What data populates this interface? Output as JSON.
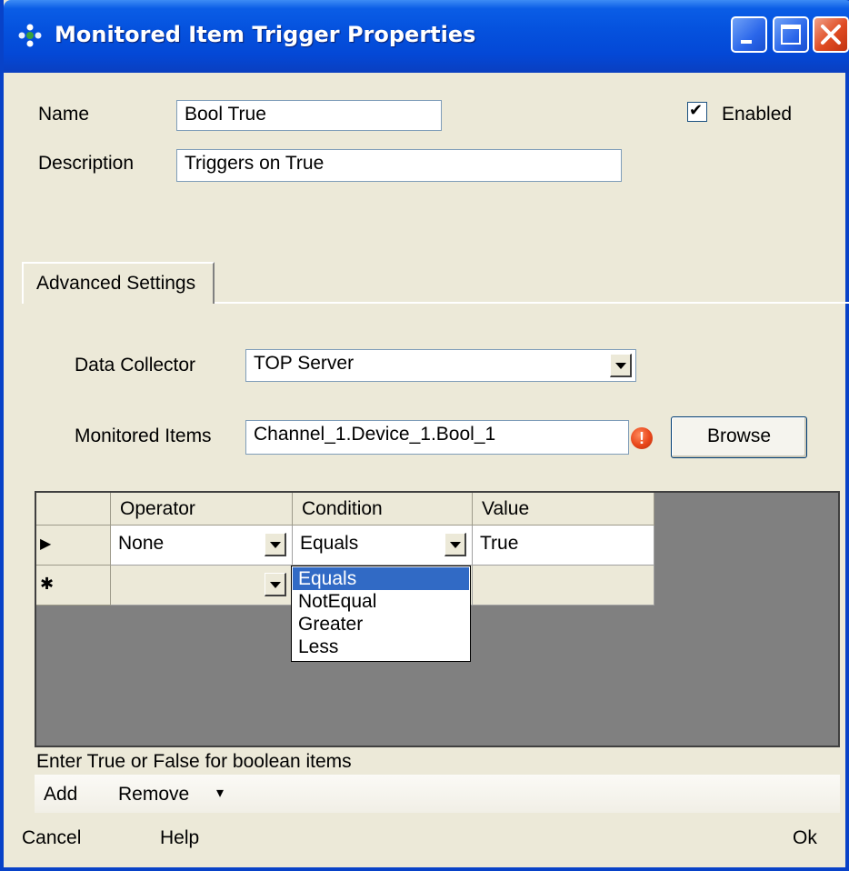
{
  "window": {
    "title": "Monitored Item Trigger Properties",
    "colors": {
      "titlebar": "#0552de",
      "face": "#ece9d8",
      "selection": "#316ac5",
      "grid_background": "#808080"
    }
  },
  "form": {
    "name_label": "Name",
    "name_value": "Bool True",
    "description_label": "Description",
    "description_value": "Triggers on True",
    "enabled_label": "Enabled",
    "enabled_checked": true
  },
  "tabs": [
    {
      "label": "Advanced Settings",
      "selected": true
    }
  ],
  "advanced": {
    "data_collector_label": "Data Collector",
    "data_collector_value": "TOP Server",
    "monitored_items_label": "Monitored Items",
    "monitored_items_value": "Channel_1.Device_1.Bool_1",
    "browse_label": "Browse",
    "warning_glyph": "!"
  },
  "grid": {
    "columns": [
      "Operator",
      "Condition",
      "Value"
    ],
    "rows": [
      {
        "indicator": "current-row-arrow",
        "operator": "None",
        "condition": "Equals",
        "value": "True"
      },
      {
        "indicator": "new-row-asterisk",
        "operator": "",
        "condition": "",
        "value": ""
      }
    ],
    "indicator_symbols": {
      "current": "▶",
      "new": "✱"
    },
    "condition_dropdown": {
      "open": true,
      "options": [
        "Equals",
        "NotEqual",
        "Greater",
        "Less"
      ],
      "selected": "Equals"
    }
  },
  "hint": "Enter True or False for boolean items",
  "toolbar": {
    "add_label": "Add",
    "remove_label": "Remove",
    "dropdown_arrow": "▾"
  },
  "footer": {
    "cancel_label": "Cancel",
    "help_label": "Help",
    "ok_label": "Ok"
  },
  "checkmark": "✔"
}
